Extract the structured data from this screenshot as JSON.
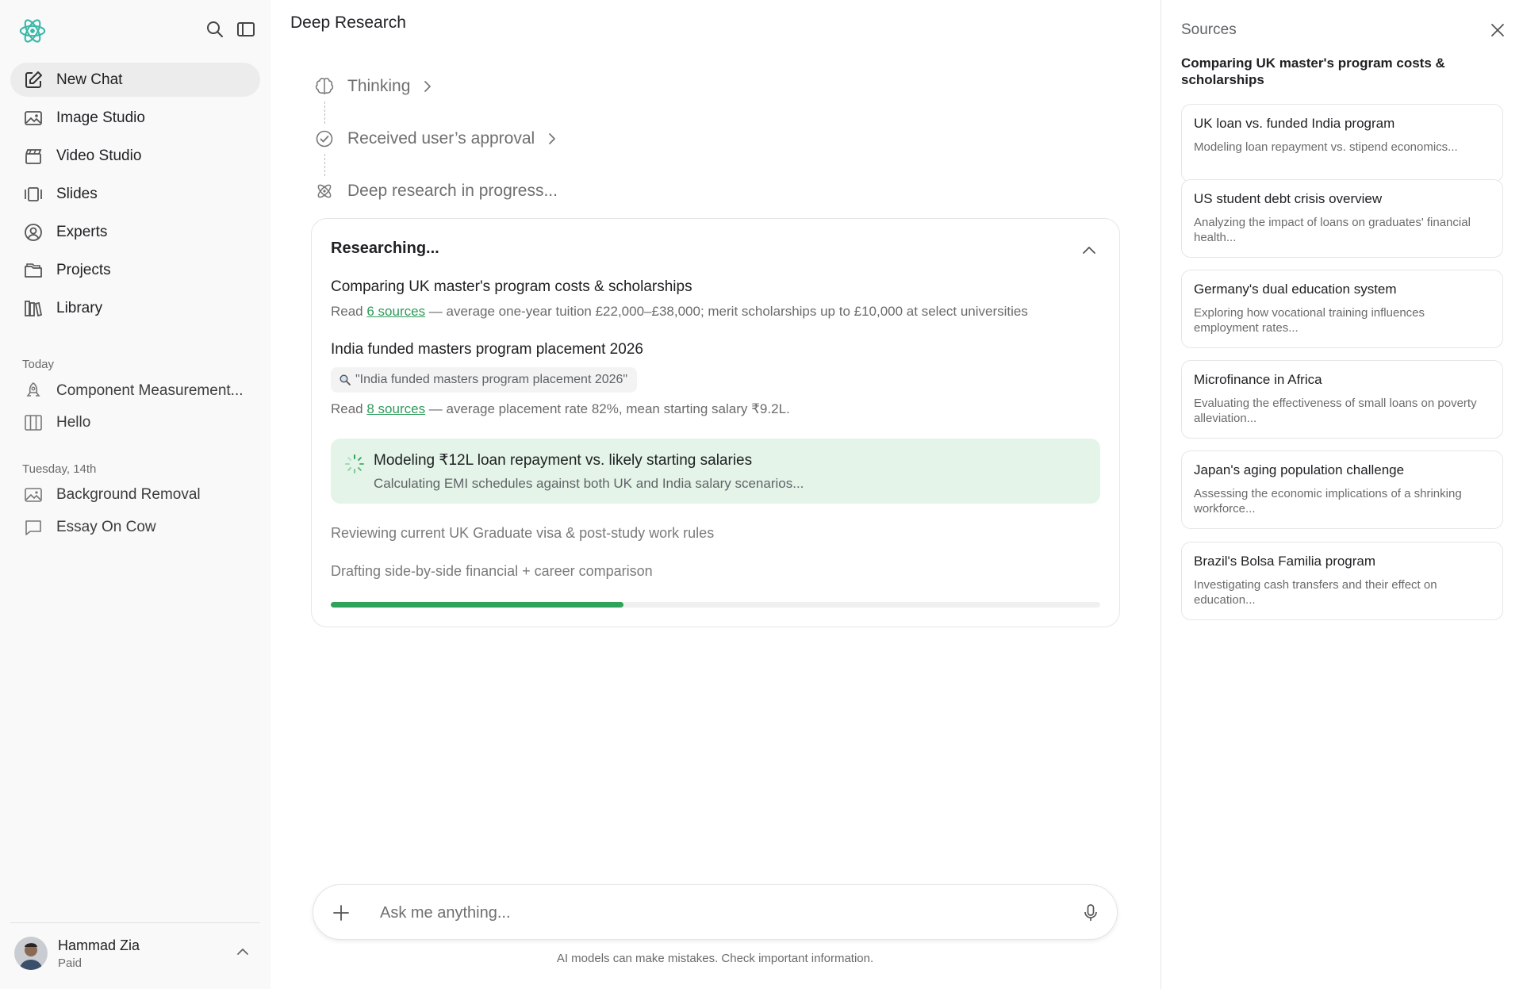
{
  "sidebar": {
    "nav": [
      {
        "label": "New Chat",
        "icon": "edit-icon"
      },
      {
        "label": "Image Studio",
        "icon": "image-icon"
      },
      {
        "label": "Video Studio",
        "icon": "clapperboard-icon"
      },
      {
        "label": "Slides",
        "icon": "slides-icon"
      },
      {
        "label": "Experts",
        "icon": "experts-icon"
      },
      {
        "label": "Projects",
        "icon": "folder-icon"
      },
      {
        "label": "Library",
        "icon": "library-icon"
      }
    ],
    "sections": [
      {
        "label": "Today",
        "items": [
          {
            "label": "Component Measurement...",
            "icon": "rocket-icon"
          },
          {
            "label": "Hello",
            "icon": "columns-icon"
          }
        ]
      },
      {
        "label": "Tuesday, 14th",
        "items": [
          {
            "label": "Background Removal",
            "icon": "image-icon"
          },
          {
            "label": "Essay On Cow",
            "icon": "chat-bubble-icon"
          }
        ]
      }
    ],
    "user": {
      "name": "Hammad Zia",
      "plan": "Paid"
    }
  },
  "main": {
    "title": "Deep Research",
    "steps": [
      {
        "label": "Thinking",
        "icon": "brain-icon"
      },
      {
        "label": "Received user’s approval",
        "icon": "check-circle-icon"
      },
      {
        "label": "Deep research in progress...",
        "icon": "atom-icon"
      }
    ],
    "card": {
      "title": "Researching...",
      "task1": {
        "title": "Comparing UK master's program costs & scholarships",
        "read_prefix": "Read ",
        "sources_link": "6 sources",
        "summary": " — average one-year tuition £22,000–£38,000; merit scholarships up to £10,000 at select universities"
      },
      "task2": {
        "title": "India funded masters program placement 2026",
        "query": "\"India funded masters program placement 2026\"",
        "read_prefix": "Read ",
        "sources_link": "8 sources",
        "summary": " — average placement rate 82%, mean starting salary ₹9.2L."
      },
      "active": {
        "title": "Modeling ₹12L loan repayment vs. likely starting salaries",
        "detail": "Calculating EMI schedules against both UK and India salary scenarios..."
      },
      "pending": [
        "Reviewing current UK Graduate visa & post-study work rules",
        "Drafting side-by-side financial + career comparison"
      ],
      "progress_percent": 38
    },
    "composer": {
      "placeholder": "Ask me anything..."
    },
    "disclaimer": "AI models can make mistakes. Check important information."
  },
  "sources": {
    "title": "Sources",
    "subtitle": "Comparing UK master's program costs & scholarships",
    "items": [
      {
        "title": "UK loan vs. funded India program",
        "desc": "Modeling loan repayment vs. stipend economics..."
      },
      {
        "title": "US student debt crisis overview",
        "desc": "Analyzing the impact of loans on graduates' financial health..."
      },
      {
        "title": "Germany's dual education system",
        "desc": "Exploring how vocational training influences employment rates..."
      },
      {
        "title": "Microfinance in Africa",
        "desc": "Evaluating the effectiveness of small loans on poverty alleviation..."
      },
      {
        "title": "Japan's aging population challenge",
        "desc": "Assessing the economic implications of a shrinking workforce..."
      },
      {
        "title": "Brazil's Bolsa Familia program",
        "desc": "Investigating cash transfers and their effect on education..."
      }
    ]
  },
  "colors": {
    "accent": "#2fa35b",
    "link": "#2e9b5b",
    "active_bg": "#e4f4e8"
  }
}
